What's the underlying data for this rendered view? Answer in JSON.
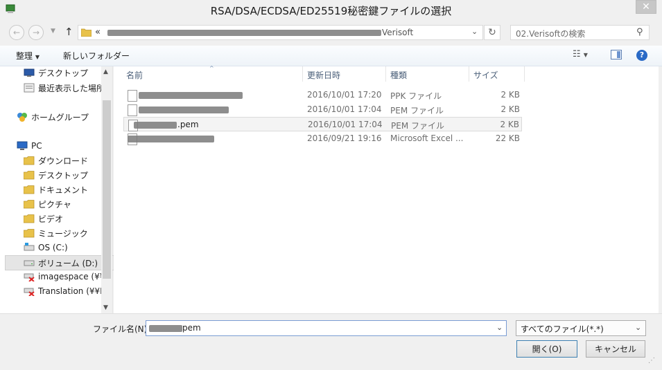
{
  "window": {
    "title": "RSA/DSA/ECDSA/ED25519秘密鍵ファイルの選択"
  },
  "icons": {
    "app": "app-icon",
    "close": "close-icon",
    "back": "back-arrow-icon",
    "forward": "forward-arrow-icon",
    "up": "up-arrow-icon",
    "refresh": "refresh-icon",
    "search": "search-icon"
  },
  "address": {
    "chevrons": "«",
    "path_visible": "Verisoft"
  },
  "search": {
    "placeholder": "02.Verisoftの検索"
  },
  "toolbar": {
    "organize": "整理",
    "new_folder": "新しいフォルダー"
  },
  "nav": {
    "items": [
      {
        "label": "デスクトップ",
        "icon": "desktop-icon"
      },
      {
        "label": "最近表示した場所",
        "icon": "recent-places-icon"
      },
      {
        "label": "ホームグループ",
        "icon": "homegroup-icon"
      },
      {
        "label": "PC",
        "icon": "pc-icon"
      },
      {
        "label": "ダウンロード",
        "icon": "downloads-folder-icon"
      },
      {
        "label": "デスクトップ",
        "icon": "desktop-folder-icon"
      },
      {
        "label": "ドキュメント",
        "icon": "documents-folder-icon"
      },
      {
        "label": "ピクチャ",
        "icon": "pictures-folder-icon"
      },
      {
        "label": "ビデオ",
        "icon": "videos-folder-icon"
      },
      {
        "label": "ミュージック",
        "icon": "music-folder-icon"
      },
      {
        "label": "OS (C:)",
        "icon": "os-drive-icon"
      },
      {
        "label": "ボリューム (D:)",
        "icon": "drive-icon"
      },
      {
        "label": "imagespace (¥¥",
        "icon": "network-drive-disconnected-icon"
      },
      {
        "label": "Translation (¥¥I",
        "icon": "network-drive-disconnected-icon"
      }
    ]
  },
  "columns": {
    "name": "名前",
    "date": "更新日時",
    "type": "種類",
    "size": "サイズ"
  },
  "files": [
    {
      "name": "",
      "ext": "",
      "date": "2016/10/01 17:20",
      "type": "PPK ファイル",
      "size": "2 KB"
    },
    {
      "name": "",
      "ext": "",
      "date": "2016/10/01 17:04",
      "type": "PEM ファイル",
      "size": "2 KB"
    },
    {
      "name": "",
      "ext": ".pem",
      "date": "2016/10/01 17:04",
      "type": "PEM ファイル",
      "size": "2 KB"
    },
    {
      "name": "",
      "ext": "",
      "date": "2016/09/21 19:16",
      "type": "Microsoft Excel ...",
      "size": "22 KB"
    }
  ],
  "filename": {
    "label": "ファイル名(N):",
    "value_visible": "pem"
  },
  "filetype": {
    "selected": "すべてのファイル(*.*)"
  },
  "buttons": {
    "open": "開く(O)",
    "cancel": "キャンセル"
  }
}
